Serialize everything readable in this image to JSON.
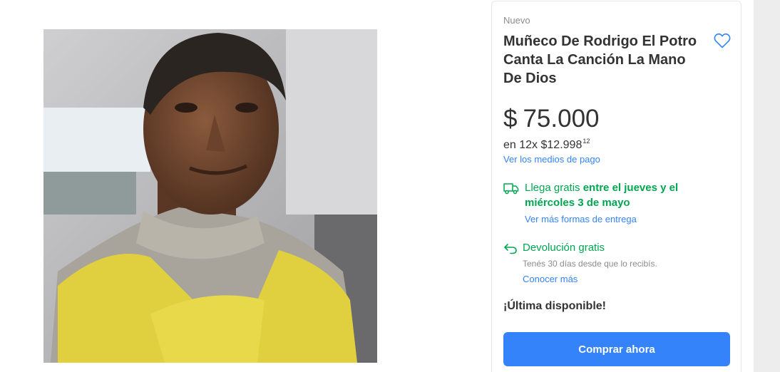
{
  "product": {
    "condition": "Nuevo",
    "title": "Muñeco De Rodrigo El Potro Canta La Canción La Mano De Dios",
    "price": {
      "symbol": "$",
      "amount": "75.000"
    },
    "installments": {
      "prefix": "en 12x",
      "symbol": "$",
      "amount": "12.998",
      "cents": "12"
    },
    "payment_link": "Ver los medios de pago"
  },
  "shipping": {
    "text_plain": "Llega gratis ",
    "text_bold": "entre el jueves y el miércoles 3 de mayo",
    "more_link": "Ver más formas de entrega"
  },
  "returns": {
    "title": "Devolución gratis",
    "subtitle": "Tenés 30 días desde que lo recibís.",
    "more_link": "Conocer más"
  },
  "stock": "¡Última disponible!",
  "buy_button": "Comprar ahora",
  "icons": {
    "favorite": "heart-outline-icon",
    "shipping": "truck-icon",
    "returns": "return-arrow-icon"
  },
  "colors": {
    "accent": "#3483fa",
    "success": "#00a650",
    "text": "#333333",
    "muted": "#8c8c8c"
  }
}
